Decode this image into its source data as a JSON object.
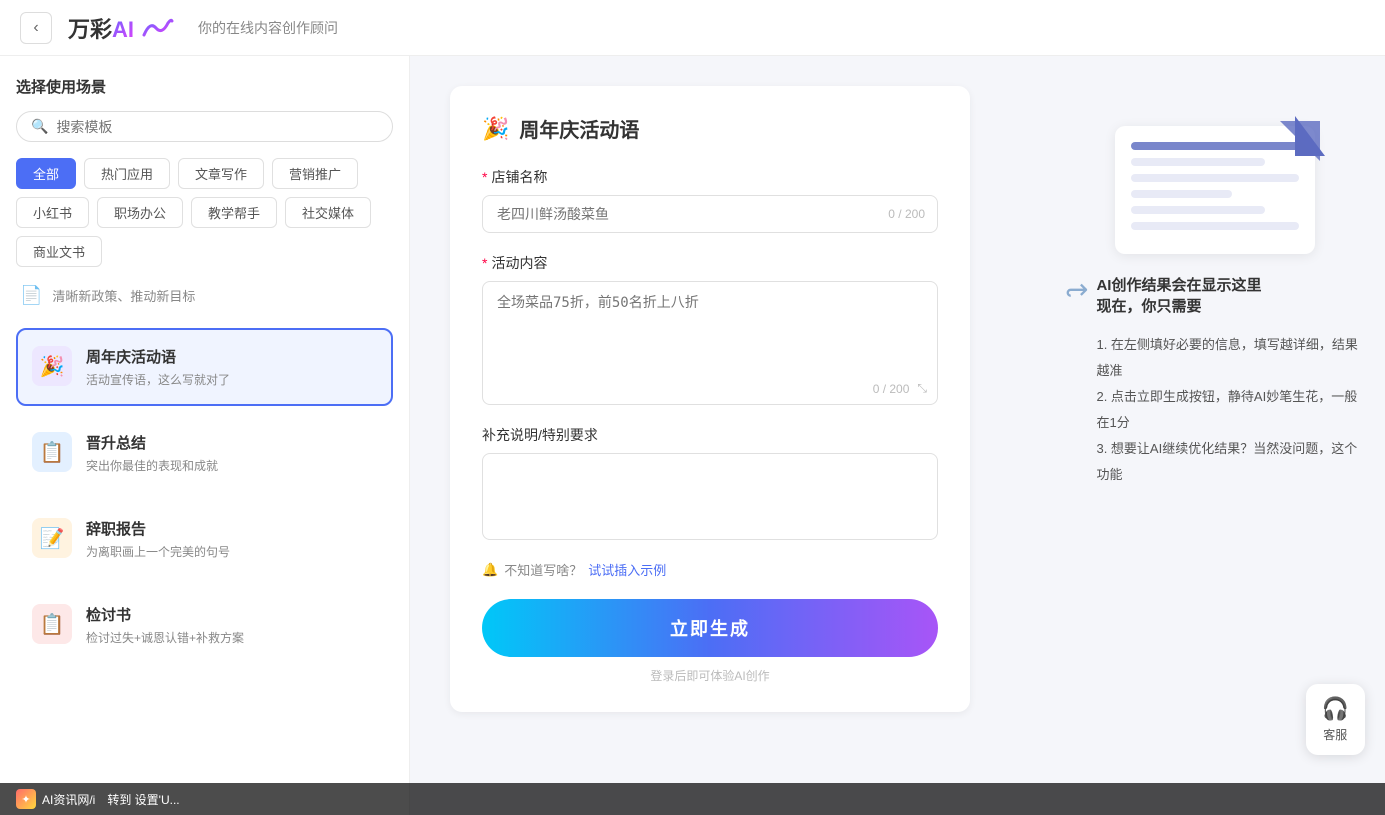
{
  "header": {
    "back_label": "‹",
    "logo_text": "万彩",
    "logo_ai": "AI",
    "subtitle": "你的在线内容创作顾问"
  },
  "sidebar": {
    "title": "选择使用场景",
    "search_placeholder": "搜索模板",
    "tags": [
      {
        "label": "全部",
        "active": true
      },
      {
        "label": "热门应用",
        "active": false
      },
      {
        "label": "文章写作",
        "active": false
      },
      {
        "label": "营销推广",
        "active": false
      },
      {
        "label": "小红书",
        "active": false
      },
      {
        "label": "职场办公",
        "active": false
      },
      {
        "label": "教学帮手",
        "active": false
      },
      {
        "label": "社交媒体",
        "active": false
      },
      {
        "label": "商业文书",
        "active": false
      }
    ],
    "separator_text": "清晰新政策、推动新目标",
    "items": [
      {
        "id": "anniversary",
        "icon": "🎉",
        "icon_style": "purple",
        "name": "周年庆活动语",
        "desc": "活动宣传语，这么写就对了",
        "active": true
      },
      {
        "id": "promotion",
        "icon": "📋",
        "icon_style": "blue",
        "name": "晋升总结",
        "desc": "突出你最佳的表现和成就",
        "active": false
      },
      {
        "id": "resignation",
        "icon": "📝",
        "icon_style": "orange",
        "name": "辞职报告",
        "desc": "为离职画上一个完美的句号",
        "active": false
      },
      {
        "id": "review",
        "icon": "📋",
        "icon_style": "red",
        "name": "检讨书",
        "desc": "检讨过失+诚恩认错+补救方案",
        "active": false
      }
    ]
  },
  "form": {
    "title": "周年庆活动语",
    "title_icon": "🎉",
    "fields": [
      {
        "id": "store_name",
        "label": "店铺名称",
        "required": true,
        "placeholder": "老四川鲜汤酸菜鱼",
        "char_count": "0 / 200",
        "type": "input"
      },
      {
        "id": "activity_content",
        "label": "活动内容",
        "required": true,
        "placeholder": "全场菜品75折，前50名折上八折",
        "char_count": "0 / 200",
        "type": "textarea"
      },
      {
        "id": "supplement",
        "label": "补充说明/特别要求",
        "required": false,
        "placeholder": "",
        "char_count": "",
        "type": "textarea"
      }
    ],
    "hint_text": "不知道写啥？试试插入示例",
    "hint_icon": "🔔",
    "generate_btn": "立即生成",
    "login_hint": "登录后即可体验AI创作"
  },
  "illustration": {
    "title_line1": "AI创作结果会在显示这里",
    "title_line2": "现在，你只需要",
    "steps": [
      "1. 在左侧填好必要的信息，填写越详细，结果越准",
      "2. 点击立即生成按钮，静待AI妙笔生花，一般在1分",
      "3. 想要让AI继续优化结果？当然没问题，这个功能"
    ]
  },
  "customer_service": {
    "label": "客服",
    "icon": "headset"
  },
  "bottom_bar": {
    "logo_text": "AI资讯网/i",
    "suffix": "转到 设置'U..."
  }
}
